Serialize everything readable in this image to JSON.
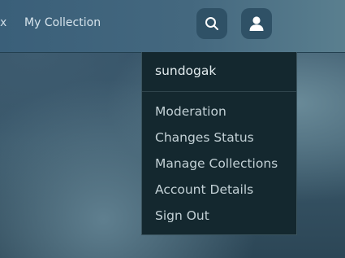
{
  "nav": {
    "cut_text": "x",
    "my_collection": "My Collection"
  },
  "icons": {
    "search": "search-icon",
    "user": "user-icon"
  },
  "menu": {
    "username": "sundogak",
    "items": [
      "Moderation",
      "Changes Status",
      "Manage Collections",
      "Account Details",
      "Sign Out"
    ]
  }
}
